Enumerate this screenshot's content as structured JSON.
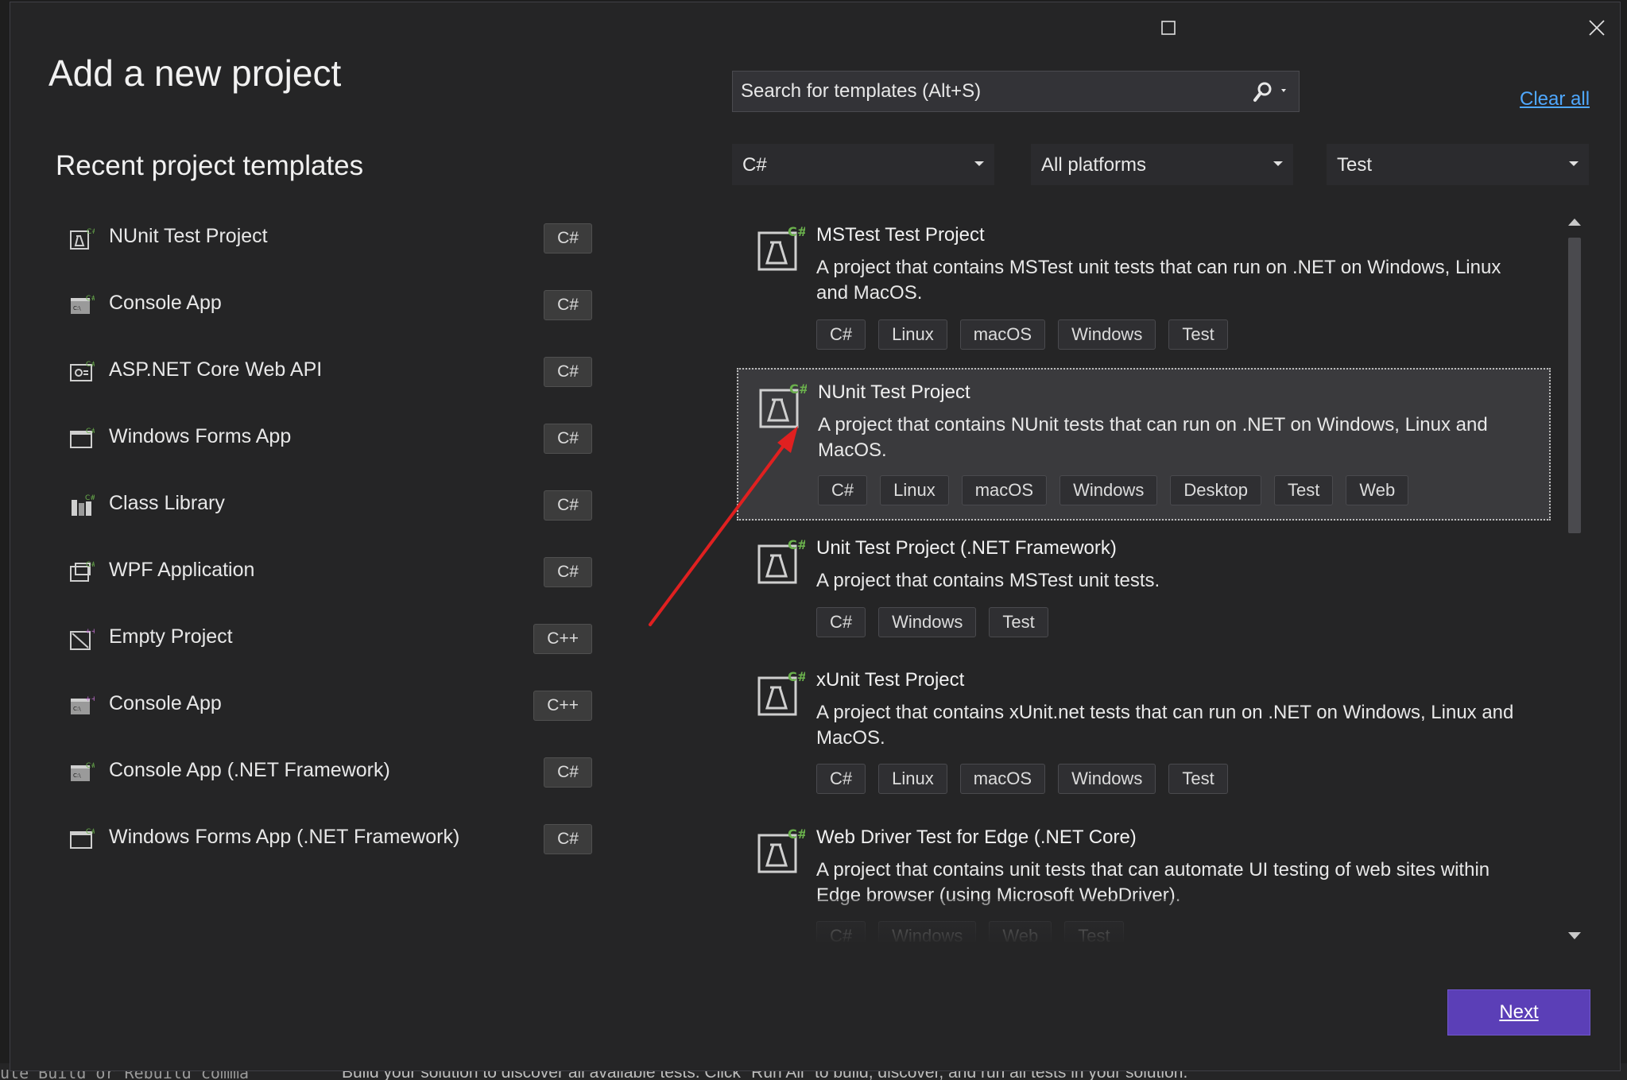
{
  "dialog": {
    "title": "Add a new project",
    "recent_heading": "Recent project templates",
    "window_controls": [
      "maximize-icon",
      "close-icon"
    ]
  },
  "recent_templates": [
    {
      "label": "NUnit Test Project",
      "lang": "C#",
      "icon": "test-project-icon"
    },
    {
      "label": "Console App",
      "lang": "C#",
      "icon": "console-app-icon"
    },
    {
      "label": "ASP.NET Core Web API",
      "lang": "C#",
      "icon": "web-api-icon"
    },
    {
      "label": "Windows Forms App",
      "lang": "C#",
      "icon": "window-form-icon"
    },
    {
      "label": "Class Library",
      "lang": "C#",
      "icon": "class-library-icon"
    },
    {
      "label": "WPF Application",
      "lang": "C#",
      "icon": "wpf-app-icon"
    },
    {
      "label": "Empty Project",
      "lang": "C++",
      "icon": "empty-project-icon"
    },
    {
      "label": "Console App",
      "lang": "C++",
      "icon": "console-app-icon"
    },
    {
      "label": "Console App (.NET Framework)",
      "lang": "C#",
      "icon": "console-app-icon"
    },
    {
      "label": "Windows Forms App (.NET Framework)",
      "lang": "C#",
      "icon": "window-form-icon"
    }
  ],
  "search": {
    "placeholder": "Search for templates (Alt+S)",
    "value": ""
  },
  "clear_all": "Clear all",
  "filters": {
    "language": "C#",
    "platform": "All platforms",
    "project_type": "Test"
  },
  "templates": [
    {
      "name": "MSTest Test Project",
      "description": "A project that contains MSTest unit tests that can run on .NET on Windows, Linux and MacOS.",
      "tags": [
        "C#",
        "Linux",
        "macOS",
        "Windows",
        "Test"
      ],
      "selected": false
    },
    {
      "name": "NUnit Test Project",
      "description": "A project that contains NUnit tests that can run on .NET on Windows, Linux and MacOS.",
      "tags": [
        "C#",
        "Linux",
        "macOS",
        "Windows",
        "Desktop",
        "Test",
        "Web"
      ],
      "selected": true
    },
    {
      "name": "Unit Test Project (.NET Framework)",
      "description": "A project that contains MSTest unit tests.",
      "tags": [
        "C#",
        "Windows",
        "Test"
      ],
      "selected": false
    },
    {
      "name": "xUnit Test Project",
      "description": "A project that contains xUnit.net tests that can run on .NET on Windows, Linux and MacOS.",
      "tags": [
        "C#",
        "Linux",
        "macOS",
        "Windows",
        "Test"
      ],
      "selected": false
    },
    {
      "name": "Web Driver Test for Edge (.NET Core)",
      "description": "A project that contains unit tests that can automate UI testing of web sites within Edge browser (using Microsoft WebDriver).",
      "tags": [
        "C#",
        "Windows",
        "Web",
        "Test"
      ],
      "selected": false
    }
  ],
  "next_button": "Next",
  "background": {
    "left_text": "ute   Build   or   Rebuild   comma",
    "right_text": "Build your solution to discover all available tests. Click \"Run All\" to build, discover, and run all tests in your solution."
  },
  "colors": {
    "accent": "#5b3fb7",
    "link": "#4fa8ff",
    "annotation_arrow": "#e02020",
    "csharp_badge": "#6ab04c"
  }
}
